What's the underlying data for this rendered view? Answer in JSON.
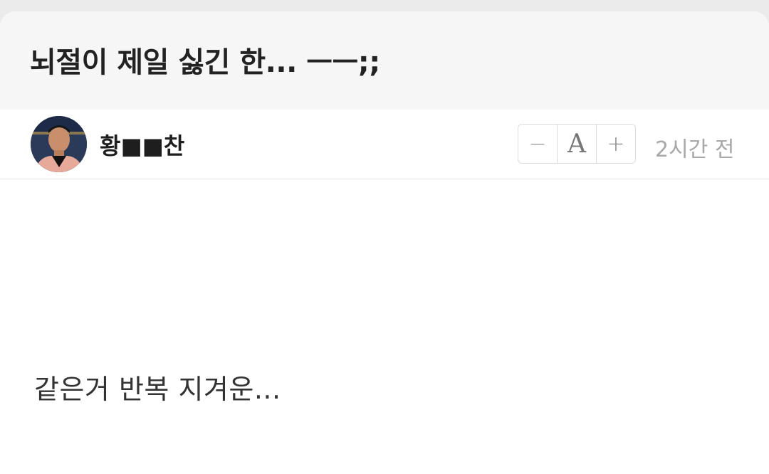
{
  "post": {
    "title": "뇌절이 제일 싫긴 한... ㅡㅡ;;",
    "author": "황■■찬",
    "timestamp": "2시간 전",
    "body": "같은거 반복 지겨운..."
  },
  "font_controls": {
    "decrease": "−",
    "size": "A",
    "increase": "+"
  }
}
